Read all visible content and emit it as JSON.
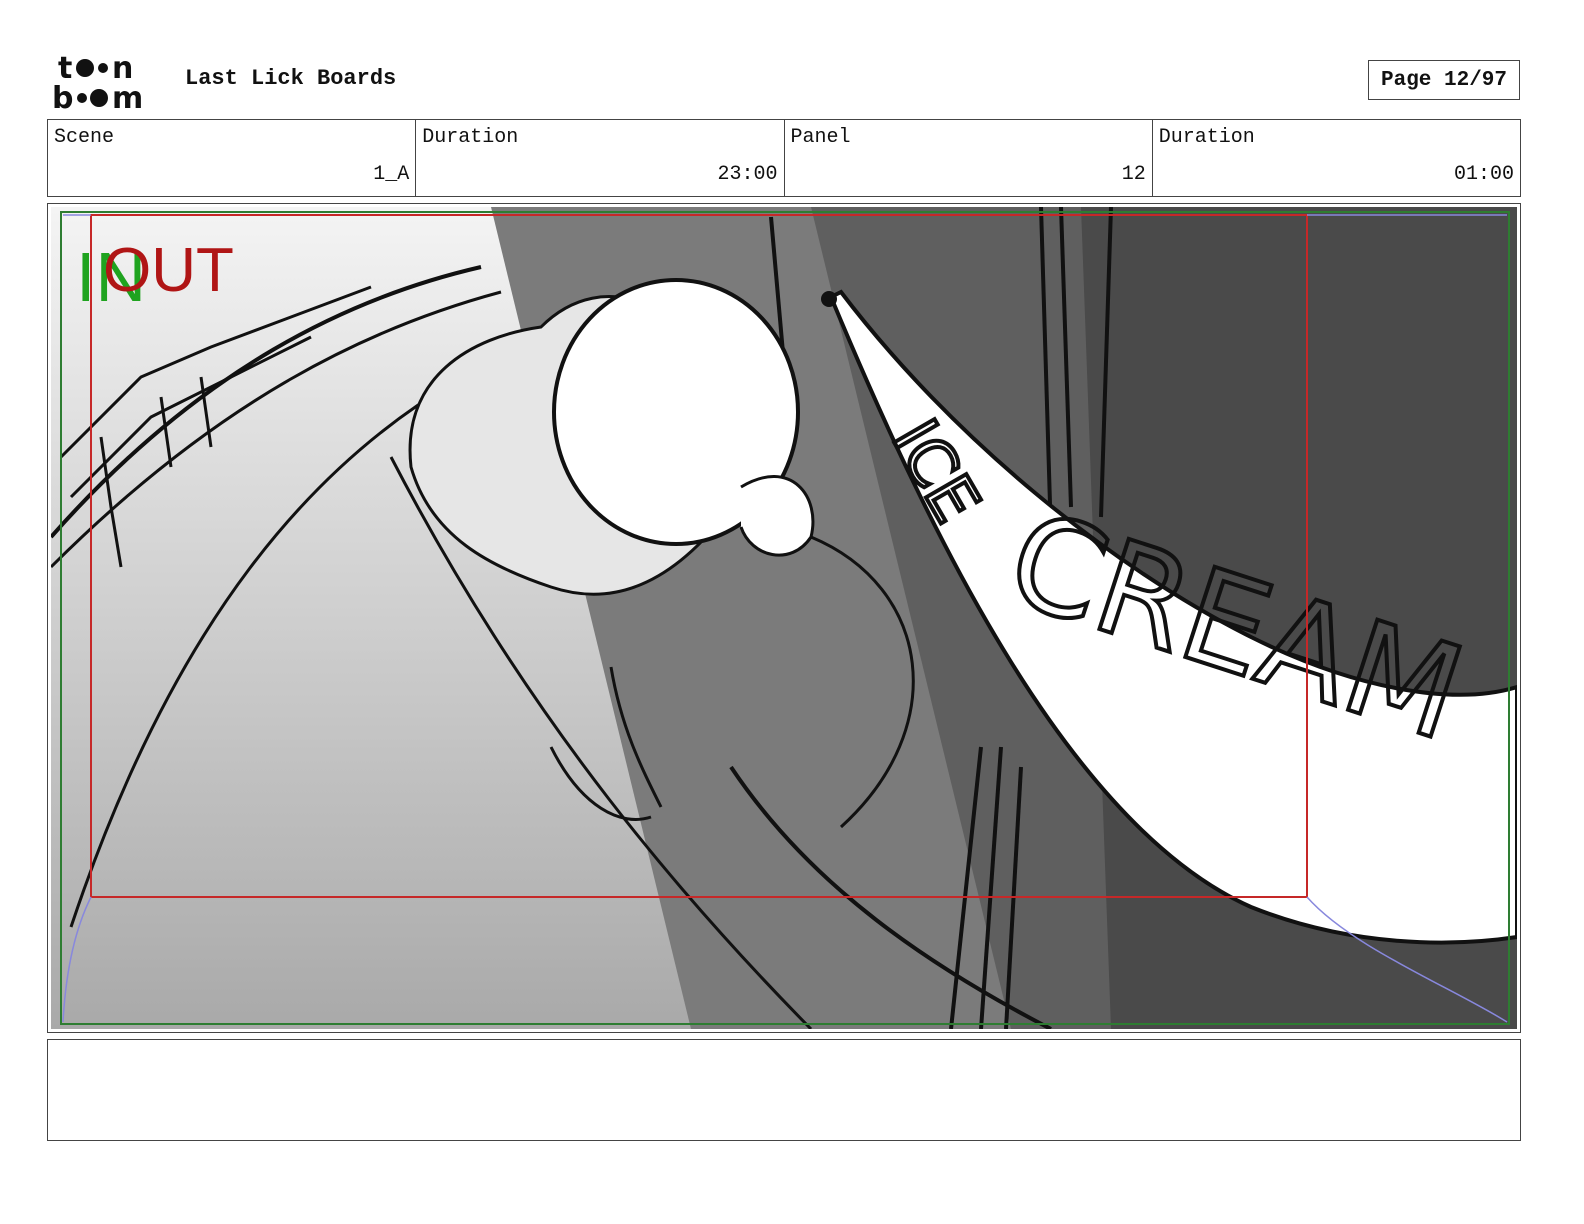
{
  "header": {
    "logo_alt": "toon boom",
    "project_title": "Last Lick Boards",
    "page_label": "Page 12/97"
  },
  "info": [
    {
      "label": "Scene",
      "value": "1_A"
    },
    {
      "label": "Duration",
      "value": "23:00"
    },
    {
      "label": "Panel",
      "value": "12"
    },
    {
      "label": "Duration",
      "value": "01:00"
    }
  ],
  "panel": {
    "in_marker": "IN",
    "out_marker": "OUT",
    "banner_line1": "ICE",
    "banner_line2": "CREAM"
  },
  "notes": {
    "text": ""
  },
  "colors": {
    "in_marker": "#1fa31f",
    "out_marker": "#b01515",
    "camera_frame_in": "#2e7d32",
    "camera_frame_out": "#c62828"
  }
}
